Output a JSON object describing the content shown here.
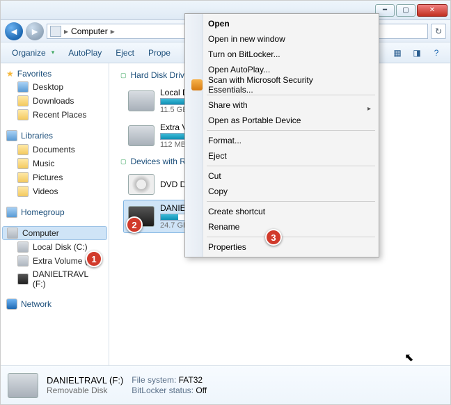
{
  "window": {
    "min": "━",
    "max": "▢",
    "close": "✕"
  },
  "breadcrumb": {
    "root": "Computer",
    "sep": "▸"
  },
  "toolbar": {
    "organize": "Organize",
    "autoplay": "AutoPlay",
    "eject": "Eject",
    "properties": "Prope"
  },
  "nav": {
    "favorites": "Favorites",
    "fav_items": [
      "Desktop",
      "Downloads",
      "Recent Places"
    ],
    "libraries": "Libraries",
    "lib_items": [
      "Documents",
      "Music",
      "Pictures",
      "Videos"
    ],
    "homegroup": "Homegroup",
    "computer": "Computer",
    "comp_items": [
      "Local Disk (C:)",
      "Extra Volume (E:)",
      "DANIELTRAVL (F:)"
    ],
    "network": "Network"
  },
  "groups": {
    "hdd": "Hard Disk Driv",
    "removable": "Devices with R"
  },
  "drives": {
    "c": {
      "name": "Local Di",
      "sub": "11.5 GB",
      "fill": 70
    },
    "e": {
      "name": "Extra Vo",
      "sub": "112 MB",
      "fill": 40
    },
    "dvd": {
      "name": "DVD Dri"
    },
    "f": {
      "name": "DANIEL",
      "sub": "24.7 GB",
      "fill": 18
    }
  },
  "context": {
    "open": "Open",
    "open_new": "Open in new window",
    "bitlocker": "Turn on BitLocker...",
    "autoplay": "Open AutoPlay...",
    "scan": "Scan with Microsoft Security Essentials...",
    "share": "Share with",
    "portable": "Open as Portable Device",
    "format": "Format...",
    "eject": "Eject",
    "cut": "Cut",
    "copy": "Copy",
    "shortcut": "Create shortcut",
    "rename": "Rename",
    "properties": "Properties"
  },
  "details": {
    "name": "DANIELTRAVL (F:)",
    "type": "Removable Disk",
    "fs_k": "File system:",
    "fs_v": "FAT32",
    "bl_k": "BitLocker status:",
    "bl_v": "Off"
  },
  "badges": {
    "1": "1",
    "2": "2",
    "3": "3"
  }
}
